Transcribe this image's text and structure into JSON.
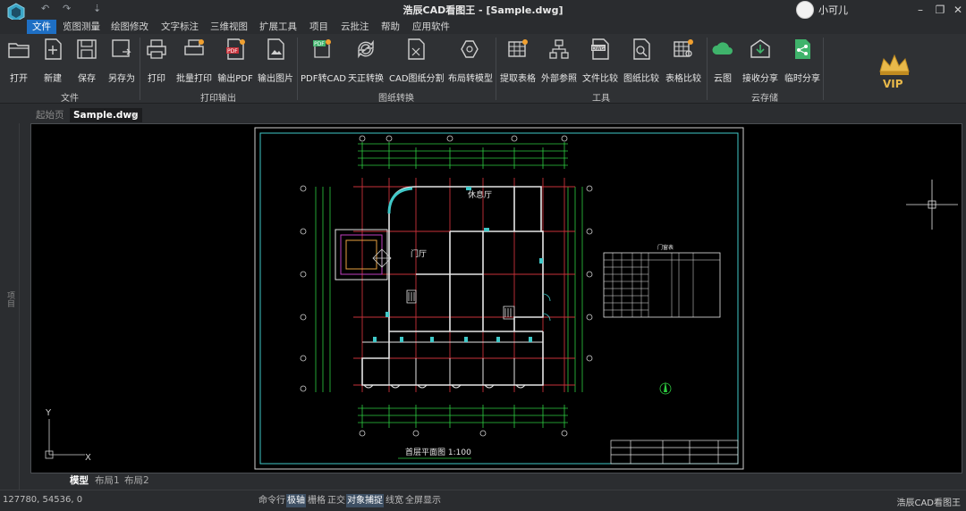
{
  "app": {
    "title": "浩辰CAD看图王 - [Sample.dwg]",
    "user_name": "小可儿",
    "brand": "浩辰CAD看图王"
  },
  "quick_access": [
    "↶",
    "↷",
    "⇣"
  ],
  "menu": [
    "文件",
    "览图测量",
    "绘图修改",
    "文字标注",
    "三维视图",
    "扩展工具",
    "项目",
    "云批注",
    "帮助",
    "应用软件"
  ],
  "ribbon": {
    "buttons": [
      {
        "label": "打开",
        "icon": "open-folder-icon"
      },
      {
        "label": "新建",
        "icon": "new-file-icon"
      },
      {
        "label": "保存",
        "icon": "save-icon"
      },
      {
        "label": "另存为",
        "icon": "save-as-icon"
      },
      {
        "label": "打印",
        "icon": "print-icon"
      },
      {
        "label": "批量打印",
        "icon": "batch-print-icon"
      },
      {
        "label": "输出PDF",
        "icon": "pdf-export-icon",
        "badge": "PDF"
      },
      {
        "label": "输出图片",
        "icon": "image-export-icon"
      },
      {
        "label": "PDF转CAD",
        "icon": "pdf-to-cad-icon",
        "badge": "PDF"
      },
      {
        "label": "天正转换",
        "icon": "tangent-convert-icon"
      },
      {
        "label": "CAD图纸分割",
        "icon": "drawing-split-icon"
      },
      {
        "label": "布局转模型",
        "icon": "layout-to-model-icon"
      },
      {
        "label": "提取表格",
        "icon": "extract-table-icon"
      },
      {
        "label": "外部参照",
        "icon": "xref-icon"
      },
      {
        "label": "文件比较",
        "icon": "file-compare-icon",
        "badge": "DWG"
      },
      {
        "label": "图纸比较",
        "icon": "drawing-compare-icon"
      },
      {
        "label": "表格比较",
        "icon": "table-compare-icon"
      },
      {
        "label": "云图",
        "icon": "cloud-icon"
      },
      {
        "label": "接收分享",
        "icon": "receive-share-icon"
      },
      {
        "label": "临时分享",
        "icon": "temp-share-icon"
      }
    ],
    "groups": [
      "文件",
      "打印输出",
      "图纸转换",
      "工具",
      "云存储"
    ],
    "vip": "VIP"
  },
  "tabs": {
    "start": "起始页",
    "doc": "Sample.dwg",
    "close": "×"
  },
  "side_panel_label": "项目",
  "drawing": {
    "room_rest": "休息厅",
    "room_lobby": "门厅",
    "floor_title": "首层平面图 1:100",
    "table_title": "门窗表",
    "ucs_x": "X",
    "ucs_y": "Y"
  },
  "layout_tabs": [
    "模型",
    "布局1",
    "布局2"
  ],
  "status": {
    "coords": "127780, 54536, 0",
    "toggles": [
      {
        "label": "命令行",
        "on": false
      },
      {
        "label": "极轴",
        "on": true
      },
      {
        "label": "栅格",
        "on": false
      },
      {
        "label": "正交",
        "on": false
      },
      {
        "label": "对象捕捉",
        "on": true
      },
      {
        "label": "线宽",
        "on": false
      },
      {
        "label": "全屏显示",
        "on": false
      }
    ]
  },
  "colors": {
    "accent": "#1e6fc4",
    "ribbon_bg": "#2f3134",
    "canvas_bg": "#000000",
    "grid_red": "#c8323a",
    "wall_white": "#e6e6e6",
    "dim_green": "#2ecc40",
    "frame_cyan": "#40c8c8",
    "icon_green": "#3fb36b",
    "icon_orange": "#f0a030"
  }
}
